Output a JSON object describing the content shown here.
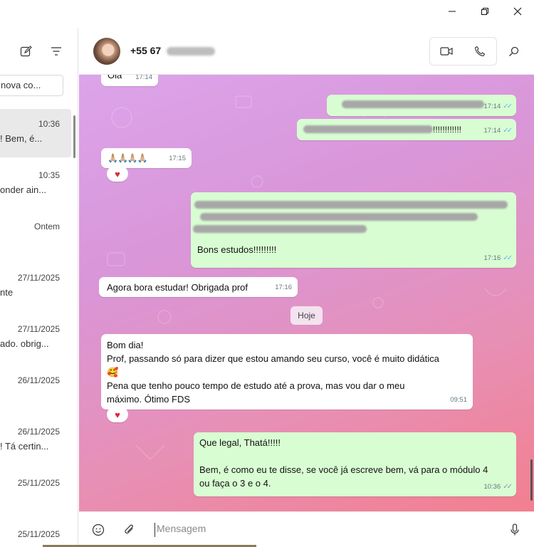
{
  "window": {
    "minimize_icon": "minimize-icon",
    "restore_icon": "restore-icon",
    "close_icon": "close-icon"
  },
  "sidebar": {
    "search_placeholder": "nova co...",
    "chats": [
      {
        "time": "10:36",
        "preview": "!  Bem, é..."
      },
      {
        "time": "10:35",
        "preview": "onder ain..."
      },
      {
        "time": "Ontem",
        "preview": ""
      },
      {
        "time": "27/11/2025",
        "preview": "nte"
      },
      {
        "time": "27/11/2025",
        "preview": "ado. obrig..."
      },
      {
        "time": "26/11/2025",
        "preview": ""
      },
      {
        "time": "26/11/2025",
        "preview": "! Tá certin..."
      },
      {
        "time": "25/11/2025",
        "preview": ""
      },
      {
        "time": "25/11/2025",
        "preview": ""
      }
    ]
  },
  "header": {
    "contact_name": "+55 67"
  },
  "messages": {
    "m0": {
      "text": "Ola",
      "time": "17:14"
    },
    "m1": {
      "time": "17:14"
    },
    "m2": {
      "text_tail": "!!!!!!!!!!!!",
      "time": "17:14"
    },
    "m3": {
      "text": "🙏🏼🙏🏼🙏🏼🙏🏼",
      "time": "17:15",
      "reaction": "♥"
    },
    "m4": {
      "text": "Bons estudos!!!!!!!!!",
      "time": "17:16"
    },
    "m5": {
      "text": "Agora bora estudar! Obrigada prof",
      "time": "17:16"
    },
    "day_chip": "Hoje",
    "m6": {
      "line1": "Bom dia!",
      "line2": "Prof, passando só para dizer que estou amando seu curso, você é muito didática",
      "line3": "🥰",
      "line4": "Pena que tenho pouco tempo de estudo até a prova, mas vou dar o meu",
      "line5": "máximo. Ótimo FDS",
      "time": "09:51",
      "reaction": "♥"
    },
    "m7": {
      "line1": "Que legal, Thatá!!!!!",
      "line2": "Bem, é como eu te disse, se você já escreve bem, vá para o módulo 4",
      "line3": "ou faça o 3 e o 4.",
      "time": "10:36"
    }
  },
  "composer": {
    "placeholder": "Mensagem"
  }
}
